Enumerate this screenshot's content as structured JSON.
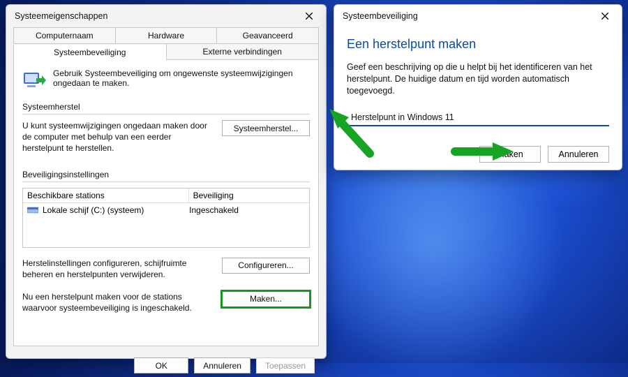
{
  "main": {
    "title": "Systeemeigenschappen",
    "tabs_row1": [
      "Computernaam",
      "Hardware",
      "Geavanceerd"
    ],
    "tabs_row2": [
      "Systeembeveiliging",
      "Externe verbindingen"
    ],
    "active_tab": "Systeembeveiliging",
    "intro": "Gebruik Systeembeveiliging om ongewenste systeemwijzigingen ongedaan te maken.",
    "section_restore_label": "Systeemherstel",
    "restore_text": "U kunt systeemwijzigingen ongedaan maken door de computer met behulp van een eerder herstelpunt te herstellen.",
    "restore_button": "Systeemherstel...",
    "section_settings_label": "Beveiligingsinstellingen",
    "table": {
      "col_name": "Beschikbare stations",
      "col_sec": "Beveiliging",
      "rows": [
        {
          "name": "Lokale schijf (C:) (systeem)",
          "sec": "Ingeschakeld"
        }
      ]
    },
    "configure_text": "Herstelinstellingen configureren, schijfruimte beheren en herstelpunten verwijderen.",
    "configure_button": "Configureren...",
    "create_text": "Nu een herstelpunt maken voor de stations waarvoor systeembeveiliging is ingeschakeld.",
    "create_button": "Maken...",
    "footer": {
      "ok": "OK",
      "cancel": "Annuleren",
      "apply": "Toepassen"
    }
  },
  "dialog": {
    "title": "Systeembeveiliging",
    "heading": "Een herstelpunt maken",
    "description": "Geef een beschrijving op die u helpt bij het identificeren van het herstelpunt. De huidige datum en tijd worden automatisch toegevoegd.",
    "input_value": "Herstelpunt in Windows 11",
    "btn_create": "Maken",
    "btn_cancel": "Annuleren"
  },
  "icons": {
    "close": "close-icon",
    "shield": "system-protection-icon",
    "drive": "drive-icon"
  }
}
